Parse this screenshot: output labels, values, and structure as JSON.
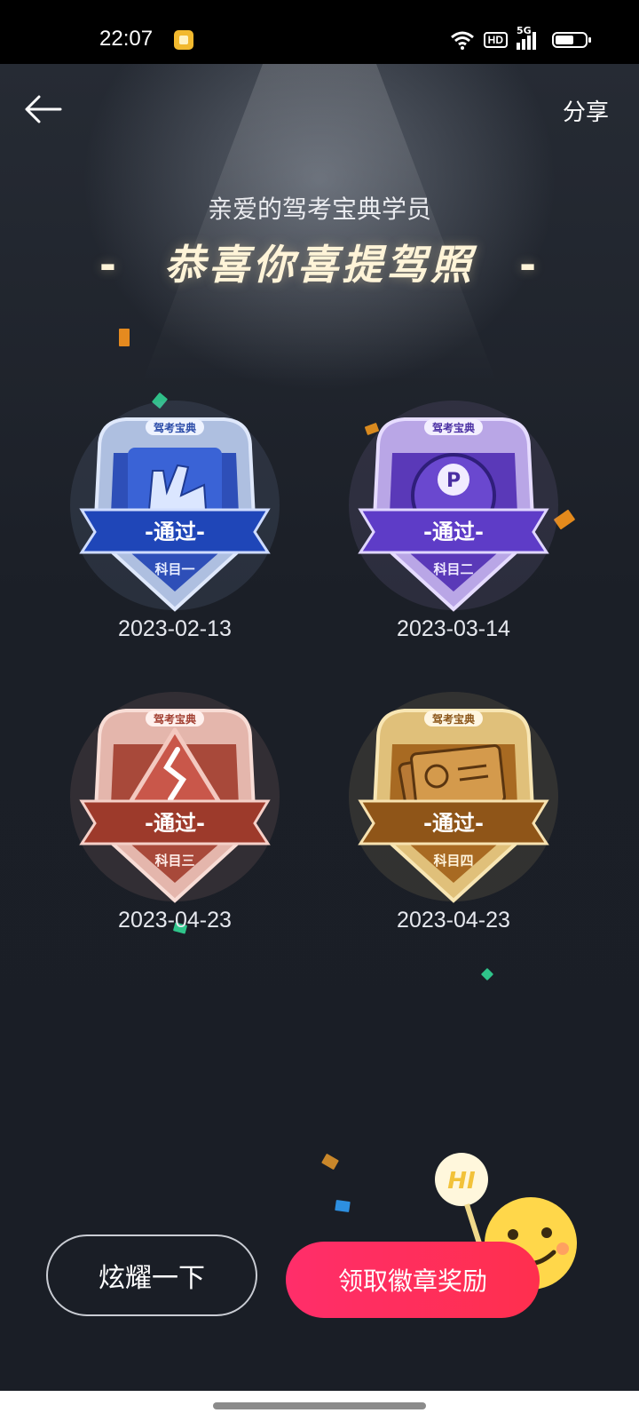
{
  "status_bar": {
    "time": "22:07",
    "hd": "HD",
    "network": "5G"
  },
  "header": {
    "share_label": "分享"
  },
  "greeting": "亲爱的驾考宝典学员",
  "headline": {
    "left_dash": "-",
    "text": "恭喜你喜提驾照",
    "right_dash": "-"
  },
  "badges": [
    {
      "brand": "驾考宝典",
      "status": "-通过-",
      "subject": "科目一",
      "date": "2023-02-13"
    },
    {
      "brand": "驾考宝典",
      "status": "-通过-",
      "subject": "科目二",
      "date": "2023-03-14",
      "symbol": "P"
    },
    {
      "brand": "驾考宝典",
      "status": "-通过-",
      "subject": "科目三",
      "date": "2023-04-23"
    },
    {
      "brand": "驾考宝典",
      "status": "-通过-",
      "subject": "科目四",
      "date": "2023-04-23"
    }
  ],
  "buttons": {
    "show_off": "炫耀一下",
    "claim": "领取徽章奖励"
  },
  "mascot": {
    "sign_text": "HI"
  },
  "colors": {
    "claim_button": "#ff2e5c",
    "headline": "#fff4d8",
    "background": "#1b1f27"
  }
}
